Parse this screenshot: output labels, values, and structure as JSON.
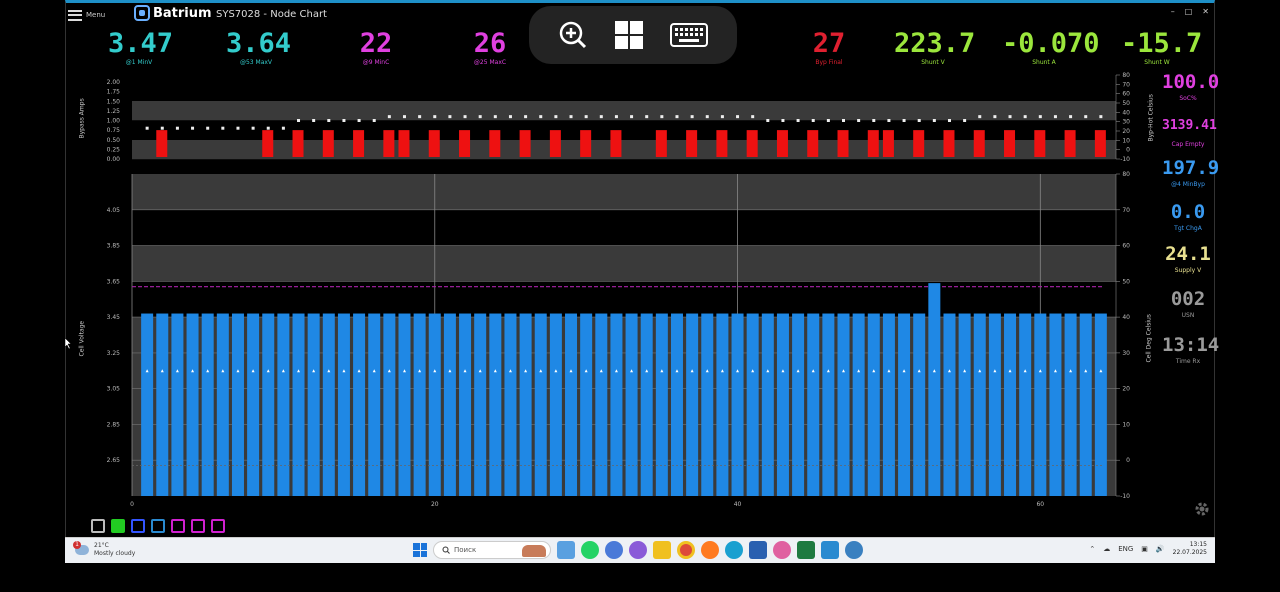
{
  "window": {
    "menu_label": "Menu",
    "brand": "Batrium",
    "title": "SYS7028 - Node Chart",
    "controls": [
      "–",
      "□",
      "✕"
    ]
  },
  "overlay_icons": [
    "zoom-in-icon",
    "windows-grid-icon",
    "keyboard-icon"
  ],
  "top_metrics": [
    {
      "value": "3.47",
      "label": "@1 MinV",
      "color": "#33cccc"
    },
    {
      "value": "3.64",
      "label": "@53 MaxV",
      "color": "#33cccc"
    },
    {
      "value": "22",
      "label": "@9 MinC",
      "color": "#e040e0"
    },
    {
      "value": "26",
      "label": "@25 MaxC",
      "color": "#e040e0"
    },
    {
      "value": "27",
      "label": "Byp Final",
      "color": "#e02030"
    },
    {
      "value": "223.7",
      "label": "Shunt V",
      "color": "#9be63c"
    },
    {
      "value": "-0.070",
      "label": "Shunt A",
      "color": "#9be63c"
    },
    {
      "value": "-15.7",
      "label": "Shunt W",
      "color": "#9be63c"
    }
  ],
  "right_metrics": [
    {
      "value": "100.0",
      "label": "SoC%",
      "color": "#e040e0"
    },
    {
      "value": "3139.41",
      "label": "Cap Empty",
      "color": "#e040e0"
    },
    {
      "value": "197.9",
      "label": "@4 MinByp",
      "color": "#3a9af0"
    },
    {
      "value": "0.0",
      "label": "Tgt ChgA",
      "color": "#3a9af0"
    },
    {
      "value": "24.1",
      "label": "Supply V",
      "color": "#e8e090"
    },
    {
      "value": "002",
      "label": "USN",
      "color": "#9a9a9a"
    },
    {
      "value": "13:14",
      "label": "Time Rx",
      "color": "#9a9a9a"
    }
  ],
  "top_chart": {
    "left_axis_label": "Bypass Amps",
    "right_axis_label": "Byp-Hot Celsius",
    "left_ticks": [
      "2.00",
      "1.75",
      "1.50",
      "1.25",
      "1.00",
      "0.75",
      "0.50",
      "0.25",
      "0.00"
    ],
    "right_ticks": [
      "80",
      "70",
      "60",
      "50",
      "40",
      "30",
      "20",
      "10",
      "0",
      "-10"
    ]
  },
  "main_chart": {
    "left_axis_label": "Cell Voltage",
    "right_axis_label": "Cell Deg Celsius",
    "left_ticks": [
      "4.05",
      "3.85",
      "3.65",
      "3.45",
      "3.25",
      "3.05",
      "2.85",
      "2.65"
    ],
    "right_ticks": [
      "80",
      "70",
      "60",
      "50",
      "40",
      "30",
      "20",
      "10",
      "0",
      "-10"
    ],
    "x_ticks": [
      "0",
      "20",
      "40",
      "60"
    ]
  },
  "chart_data": {
    "type": "bar",
    "xlabel": "",
    "ylabel": "Cell Voltage",
    "ylim": [
      2.45,
      4.25
    ],
    "xlim": [
      0,
      65
    ],
    "cell_count": 64,
    "voltage_high_cell": 53,
    "voltage_high": 3.64,
    "voltage_typical": 3.47,
    "temperature_celsius_typical": 25,
    "reference_line_voltage": 3.62,
    "bypass_active_cells": [
      2,
      9,
      11,
      13,
      15,
      17,
      18,
      20,
      22,
      24,
      26,
      28,
      30,
      32,
      35,
      37,
      39,
      41,
      43,
      45,
      47,
      49,
      50,
      52,
      54,
      56,
      58,
      60,
      62,
      64
    ],
    "bypass_amps_dots_low": 0.8,
    "bypass_amps_dots_mid": 1.0,
    "bypass_amps_dots_high": 1.1,
    "grid": true
  },
  "bottom_toolbar_icons": [
    "cell-view-icon",
    "run-icon",
    "gear-small-icon",
    "card-icon",
    "grid-icon-1",
    "grid-icon-2",
    "grid-icon-3"
  ],
  "taskbar": {
    "weather_temp": "21°C",
    "weather_text": "Mostly cloudy",
    "weather_badge": "1",
    "search_placeholder": "Поиск",
    "lang": "ENG",
    "time": "13:15",
    "date": "22.07.2025"
  }
}
